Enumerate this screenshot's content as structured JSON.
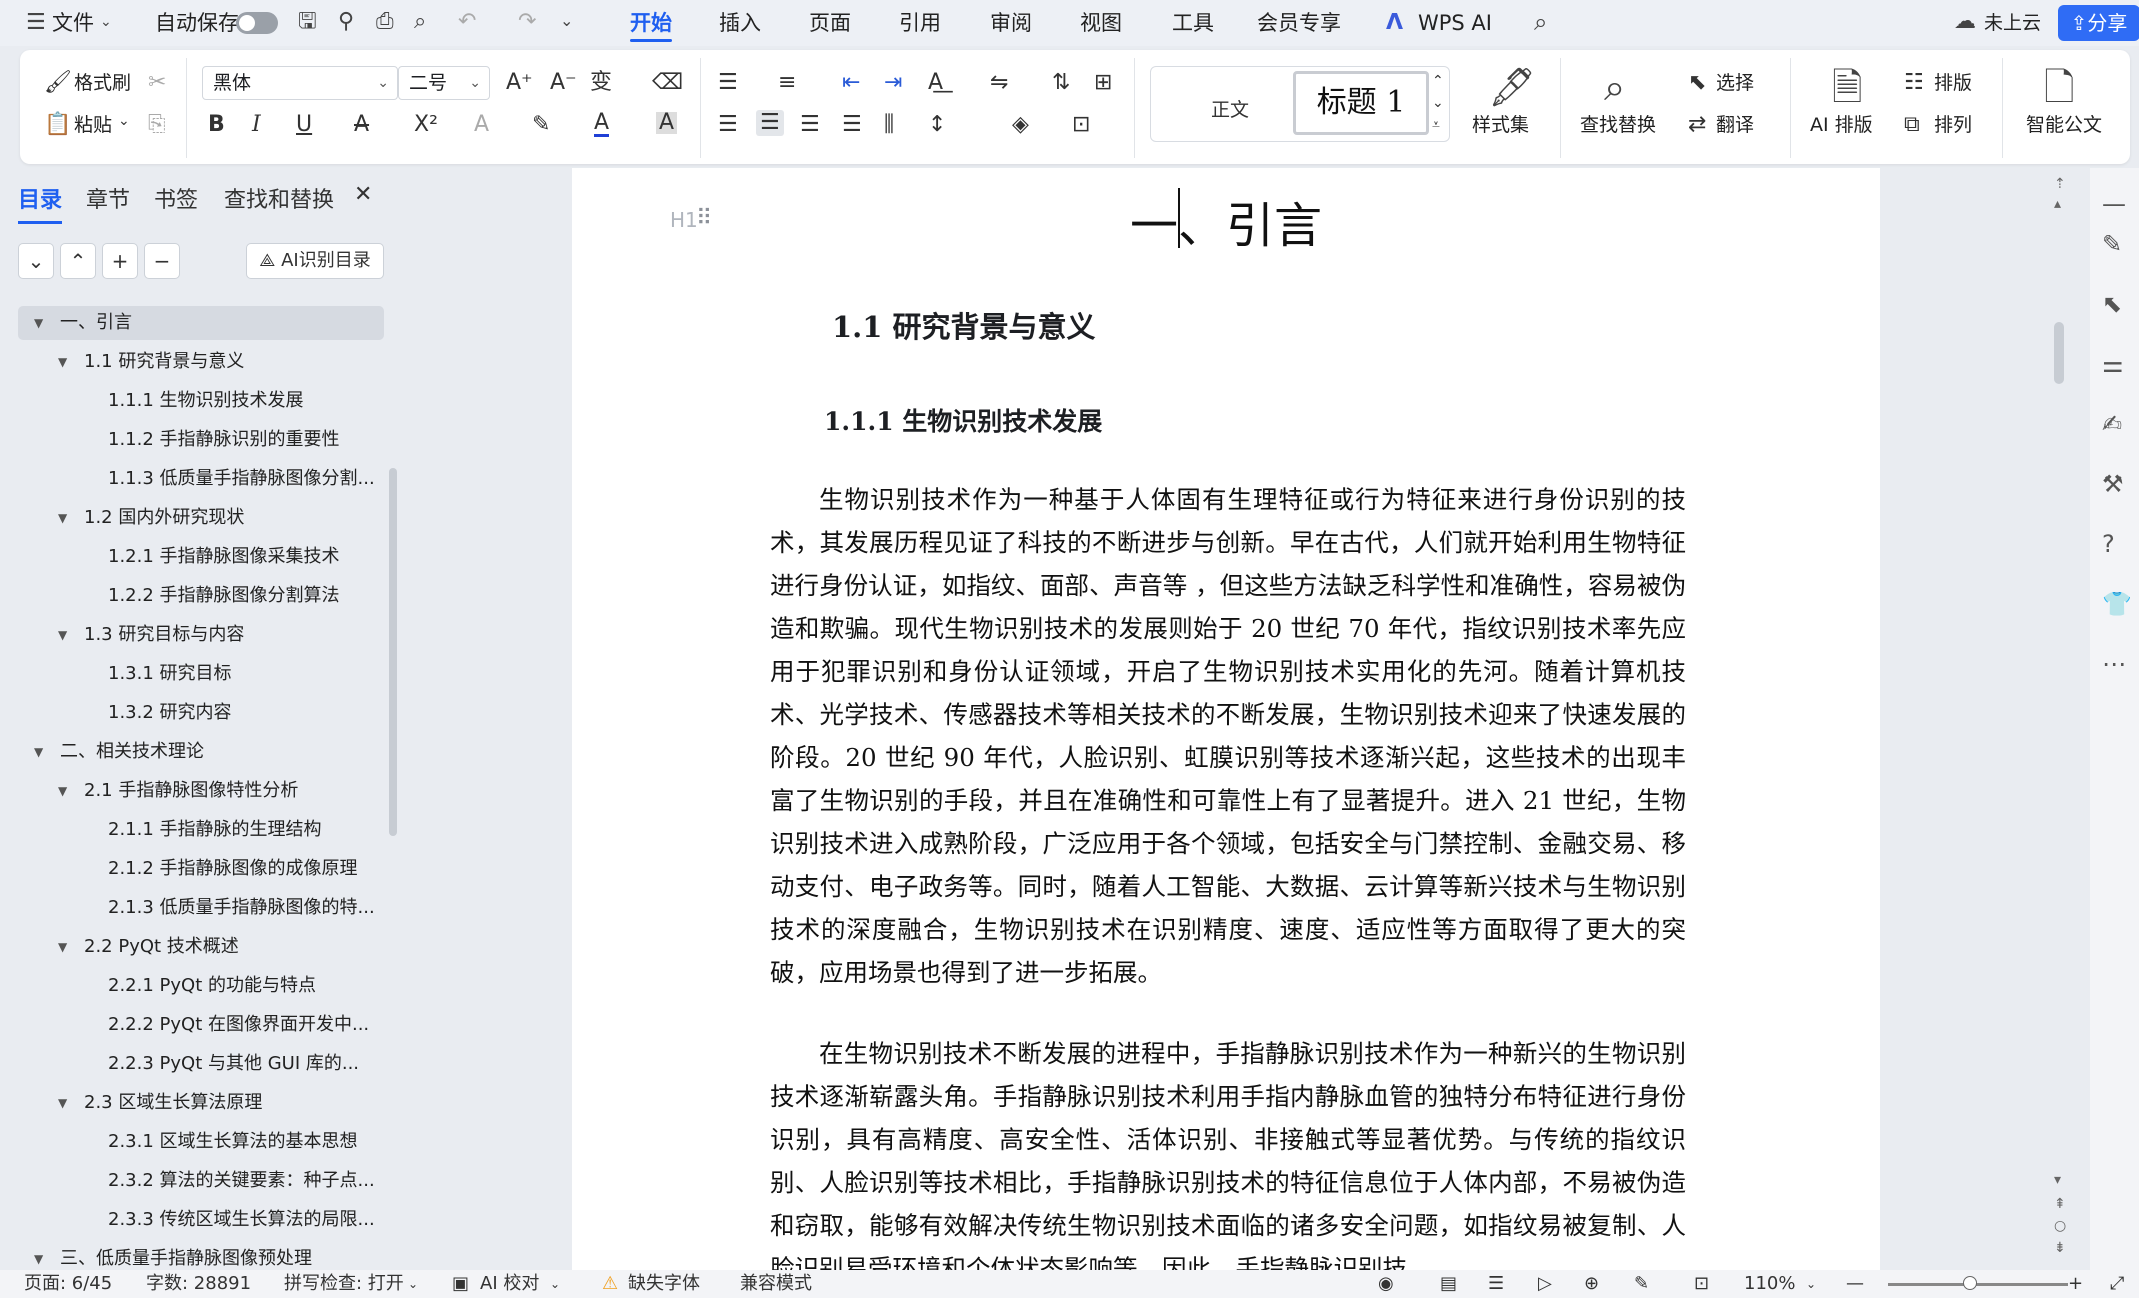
{
  "menubar": {
    "file": "文件",
    "autosave": "自动保存",
    "tabs": [
      "开始",
      "插入",
      "页面",
      "引用",
      "审阅",
      "视图",
      "工具",
      "会员专享"
    ],
    "wps_ai": "WPS AI",
    "cloud_status": "未上云",
    "share": "分享"
  },
  "ribbon": {
    "format_painter": "格式刷",
    "paste": "粘贴",
    "font_name": "黑体",
    "font_size": "二号",
    "style_normal": "正文",
    "style_heading": "标题 1",
    "style_set": "样式集",
    "find_replace": "查找替换",
    "select": "选择",
    "translate": "翻译",
    "ai_layout": "AI 排版",
    "layout": "排版",
    "arrange": "排列",
    "smart_doc": "智能公文"
  },
  "nav": {
    "tabs": [
      "目录",
      "章节",
      "书签",
      "查找和替换"
    ],
    "ai_toc": "AI识别目录",
    "toc": [
      {
        "label": "一、引言",
        "level": 0,
        "selected": true
      },
      {
        "label": "1.1  研究背景与意义",
        "level": 1
      },
      {
        "label": "1.1.1  生物识别技术发展",
        "level": 2
      },
      {
        "label": "1.1.2  手指静脉识别的重要性",
        "level": 2
      },
      {
        "label": "1.1.3  低质量手指静脉图像分割...",
        "level": 2
      },
      {
        "label": "1.2  国内外研究现状",
        "level": 1
      },
      {
        "label": "1.2.1  手指静脉图像采集技术",
        "level": 2
      },
      {
        "label": "1.2.2  手指静脉图像分割算法",
        "level": 2
      },
      {
        "label": "1.3  研究目标与内容",
        "level": 1
      },
      {
        "label": "1.3.1  研究目标",
        "level": 2
      },
      {
        "label": "1.3.2  研究内容",
        "level": 2
      },
      {
        "label": "二、相关技术理论",
        "level": 0
      },
      {
        "label": "2.1  手指静脉图像特性分析",
        "level": 1
      },
      {
        "label": "2.1.1  手指静脉的生理结构",
        "level": 2
      },
      {
        "label": "2.1.2  手指静脉图像的成像原理",
        "level": 2
      },
      {
        "label": "2.1.3  低质量手指静脉图像的特...",
        "level": 2
      },
      {
        "label": "2.2 PyQt  技术概述",
        "level": 1
      },
      {
        "label": "2.2.1 PyQt  的功能与特点",
        "level": 2
      },
      {
        "label": "2.2.2 PyQt  在图像界面开发中...",
        "level": 2
      },
      {
        "label": "2.2.3 PyQt  与其他 GUI 库的...",
        "level": 2
      },
      {
        "label": "2.3  区域生长算法原理",
        "level": 1
      },
      {
        "label": "2.3.1  区域生长算法的基本思想",
        "level": 2
      },
      {
        "label": "2.3.2  算法的关键要素：种子点...",
        "level": 2
      },
      {
        "label": "2.3.3  传统区域生长算法的局限...",
        "level": 2
      },
      {
        "label": "三、低质量手指静脉图像预处理",
        "level": 0
      }
    ]
  },
  "doc": {
    "h1": "一、引言",
    "h1_marker": "H1",
    "h2": "1.1  研究背景与意义",
    "h3": "1.1.1  生物识别技术发展",
    "p1": "生物识别技术作为一种基于人体固有生理特征或行为特征来进行身份识别的技术，其发展历程见证了科技的不断进步与创新。早在古代，人们就开始利用生物特征进行身份认证，如指纹、面部、声音等 ，但这些方法缺乏科学性和准确性，容易被伪造和欺骗。现代生物识别技术的发展则始于 20 世纪 70 年代，指纹识别技术率先应用于犯罪识别和身份认证领域，开启了生物识别技术实用化的先河。随着计算机技术、光学技术、传感器技术等相关技术的不断发展，生物识别技术迎来了快速发展的阶段。20 世纪 90 年代，人脸识别、虹膜识别等技术逐渐兴起，这些技术的出现丰富了生物识别的手段，并且在准确性和可靠性上有了显著提升。进入 21 世纪，生物识别技术进入成熟阶段，广泛应用于各个领域，包括安全与门禁控制、金融交易、移动支付、电子政务等。同时，随着人工智能、大数据、云计算等新兴技术与生物识别技术的深度融合，生物识别技术在识别精度、速度、适应性等方面取得了更大的突破，应用场景也得到了进一步拓展。",
    "p2": "在生物识别技术不断发展的进程中，手指静脉识别技术作为一种新兴的生物识别技术逐渐崭露头角。手指静脉识别技术利用手指内静脉血管的独特分布特征进行身份识别，具有高精度、高安全性、活体识别、非接触式等显著优势。与传统的指纹识别、人脸识别等技术相比，手指静脉识别技术的特征信息位于人体内部，不易被伪造和窃取，能够有效解决传统生物识别技术面临的诸多安全问题，如指纹易被复制、人脸识别易受环境和个体状态影响等。因此，手指静脉识别技"
  },
  "statusbar": {
    "page": "页面: 6/45",
    "words": "字数: 28891",
    "spellcheck": "拼写检查: 打开",
    "ai_proof": "AI 校对",
    "missing_font": "缺失字体",
    "compat_mode": "兼容模式",
    "zoom": "110%"
  },
  "colors": {
    "accent": "#1f5ff0",
    "share_bg": "#2f6cf5",
    "background": "#e9ecf1"
  }
}
